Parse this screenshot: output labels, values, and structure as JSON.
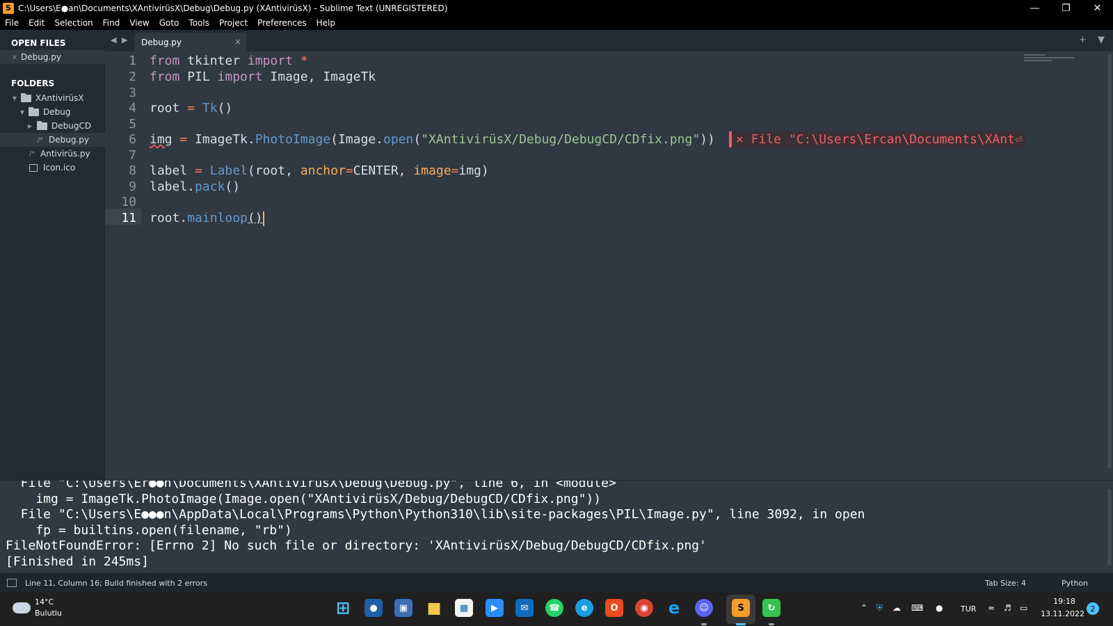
{
  "window": {
    "title": "C:\\Users\\E●an\\Documents\\XAntivirüsX\\Debug\\Debug.py (XAntivirüsX) - Sublime Text (UNREGISTERED)",
    "minimize": "—",
    "maximize": "❐",
    "close": "✕"
  },
  "menu": [
    "File",
    "Edit",
    "Selection",
    "Find",
    "View",
    "Goto",
    "Tools",
    "Project",
    "Preferences",
    "Help"
  ],
  "sidebar": {
    "open_files_header": "OPEN FILES",
    "open_files": [
      {
        "name": "Debug.py",
        "mark": "×"
      }
    ],
    "folders_header": "FOLDERS",
    "tree": [
      {
        "name": "XAntivirüsX",
        "type": "folder",
        "expanded": true
      },
      {
        "name": "Debug",
        "type": "folder",
        "expanded": true
      },
      {
        "name": "DebugCD",
        "type": "folder",
        "expanded": false
      },
      {
        "name": "Debug.py",
        "type": "file",
        "mark": "/*",
        "selected": true
      },
      {
        "name": "Antivirüs.py",
        "type": "file",
        "mark": "/*"
      },
      {
        "name": "Icon.ico",
        "type": "image"
      }
    ]
  },
  "tabs": {
    "nav": "◀ ▶",
    "active": "Debug.py",
    "close": "×",
    "tools": "+ ▼"
  },
  "editor": {
    "line_numbers": [
      "1",
      "2",
      "3",
      "4",
      "5",
      "6",
      "7",
      "8",
      "9",
      "10",
      "11"
    ],
    "current_line": 11,
    "code": {
      "l1": [
        "from",
        " tkinter ",
        "import",
        " ",
        "*"
      ],
      "l2": [
        "from",
        " PIL ",
        "import",
        " Image, ImageTk"
      ],
      "l4": [
        "root",
        " ",
        "=",
        " ",
        "Tk",
        "()"
      ],
      "l6": [
        "img",
        " ",
        "=",
        " ImageTk.",
        "PhotoImage",
        "(Image.",
        "open",
        "(",
        "\"XAntivirüsX/Debug/DebugCD/CDfix.png\"",
        "))"
      ],
      "l8": [
        "label",
        " ",
        "=",
        " ",
        "Label",
        "(root, ",
        "anchor",
        "=",
        "CENTER, ",
        "image",
        "=",
        "img)"
      ],
      "l9": [
        "label.",
        "pack",
        "()"
      ],
      "l11": [
        "root.",
        "mainloop",
        "()"
      ]
    },
    "phantom_error": "× File \"C:\\Users\\Ercan\\Documents\\XAnt⏎"
  },
  "output": {
    "lines": [
      "  File \"C:\\Users\\Er●●n\\Documents\\XAntivirüsX\\Debug\\Debug.py\", line 6, in <module>",
      "    img = ImageTk.PhotoImage(Image.open(\"XAntivirüsX/Debug/DebugCD/CDfix.png\"))",
      "  File \"C:\\Users\\E●●●n\\AppData\\Local\\Programs\\Python\\Python310\\lib\\site-packages\\PIL\\Image.py\", line 3092, in open",
      "    fp = builtins.open(filename, \"rb\")",
      "FileNotFoundError: [Errno 2] No such file or directory: 'XAntivirüsX/Debug/DebugCD/CDfix.png'",
      "[Finished in 245ms]"
    ]
  },
  "status": {
    "message": "Line 11, Column 16; Build finished with 2 errors",
    "tab_size": "Tab Size: 4",
    "syntax": "Python"
  },
  "taskbar": {
    "weather_temp": "14°C",
    "weather_cond": "Bulutlu",
    "apps": [
      {
        "name": "windows-start",
        "glyph": "⊞",
        "color": "#4cc2ff"
      },
      {
        "name": "widgets",
        "glyph": "●",
        "color": "#3a8ee6"
      },
      {
        "name": "control-panel",
        "glyph": "▣",
        "color": "#5b8bd1"
      },
      {
        "name": "file-explorer",
        "glyph": "■",
        "color": "#f2c94c"
      },
      {
        "name": "microsoft-store",
        "glyph": "▦",
        "color": "#e6e6e6"
      },
      {
        "name": "zoom",
        "glyph": "▶",
        "color": "#2d8cff"
      },
      {
        "name": "mail",
        "glyph": "✉",
        "color": "#0f6cbd"
      },
      {
        "name": "whatsapp",
        "glyph": "☎",
        "color": "#25d366"
      },
      {
        "name": "edge",
        "glyph": "e",
        "color": "#1b9de2"
      },
      {
        "name": "office",
        "glyph": "O",
        "color": "#e74a1c"
      },
      {
        "name": "chrome",
        "glyph": "◉",
        "color": "#db4437"
      },
      {
        "name": "internet-explorer",
        "glyph": "e",
        "color": "#1ea0f1"
      },
      {
        "name": "discord",
        "glyph": "☺",
        "color": "#5865f2"
      },
      {
        "name": "sublime-text",
        "glyph": "S",
        "color": "#f59c2a"
      },
      {
        "name": "update-app",
        "glyph": "↻",
        "color": "#36c24e"
      }
    ],
    "language": "TUR",
    "time": "19:18",
    "date": "13.11.2022",
    "notifications": "2"
  }
}
